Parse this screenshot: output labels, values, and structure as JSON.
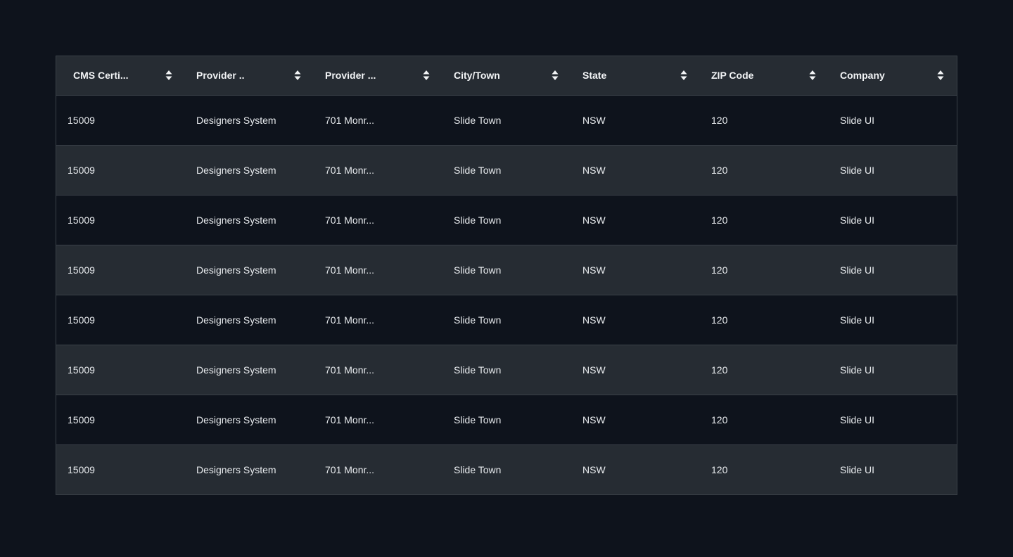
{
  "table": {
    "columns": [
      {
        "label": "CMS Certi...",
        "sort_icon": "sort-icon"
      },
      {
        "label": "Provider ..",
        "sort_icon": "sort-icon"
      },
      {
        "label": "Provider ...",
        "sort_icon": "sort-icon"
      },
      {
        "label": "City/Town",
        "sort_icon": "sort-icon"
      },
      {
        "label": "State",
        "sort_icon": "sort-icon"
      },
      {
        "label": "ZIP Code",
        "sort_icon": "sort-icon"
      },
      {
        "label": "Company",
        "sort_icon": "sort-icon"
      }
    ],
    "rows": [
      [
        "15009",
        "Designers System",
        "701 Monr...",
        "Slide Town",
        "NSW",
        "120",
        "Slide UI"
      ],
      [
        "15009",
        "Designers System",
        "701 Monr...",
        "Slide Town",
        "NSW",
        "120",
        "Slide UI"
      ],
      [
        "15009",
        "Designers System",
        "701 Monr...",
        "Slide Town",
        "NSW",
        "120",
        "Slide UI"
      ],
      [
        "15009",
        "Designers System",
        "701 Monr...",
        "Slide Town",
        "NSW",
        "120",
        "Slide UI"
      ],
      [
        "15009",
        "Designers System",
        "701 Monr...",
        "Slide Town",
        "NSW",
        "120",
        "Slide UI"
      ],
      [
        "15009",
        "Designers System",
        "701 Monr...",
        "Slide Town",
        "NSW",
        "120",
        "Slide UI"
      ],
      [
        "15009",
        "Designers System",
        "701 Monr...",
        "Slide Town",
        "NSW",
        "120",
        "Slide UI"
      ],
      [
        "15009",
        "Designers System",
        "701 Monr...",
        "Slide Town",
        "NSW",
        "120",
        "Slide UI"
      ]
    ]
  },
  "colors": {
    "background": "#0e131c",
    "header_bg": "#262c33",
    "row_alt_bg": "#262c33",
    "border": "#3a4048",
    "text": "#f2f4f6"
  }
}
